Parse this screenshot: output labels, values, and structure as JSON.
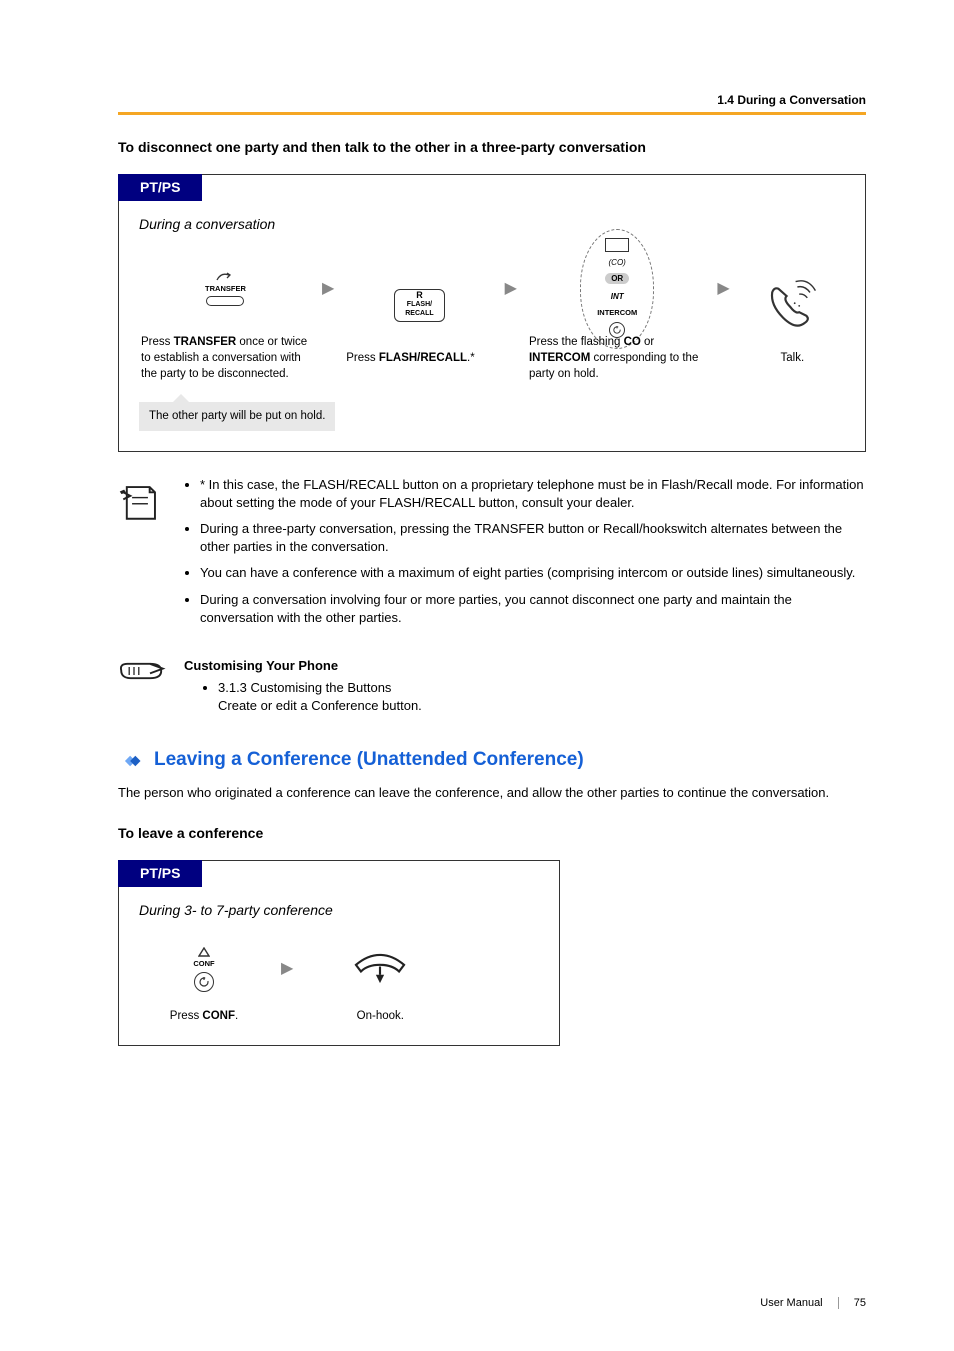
{
  "header": {
    "breadcrumb": "1.4 During a Conversation"
  },
  "subhead1": "To disconnect one party and then talk to the other in a three-party conversation",
  "flow1": {
    "title": "PT/PS",
    "context": "During a conversation",
    "steps": {
      "s1": {
        "iconLabel1": "TRANSFER",
        "caption_pre": "Press ",
        "caption_b1": "TRANSFER",
        "caption_post": " once or twice to establish a conversation with the party to be disconnected."
      },
      "s2": {
        "iconLabel1": "R",
        "iconLabel2": "FLASH/\nRECALL",
        "caption_pre": "Press ",
        "caption_b1": "FLASH/RECALL",
        "caption_post": ".*"
      },
      "s3": {
        "coLabel": "(CO)",
        "orLabel": "OR",
        "intLabel1": "INT",
        "intLabel2": "INTERCOM",
        "caption_pre": "Press the flashing ",
        "caption_b1": "CO",
        "caption_mid": " or ",
        "caption_b2": "INTERCOM",
        "caption_post": " corresponding to the party on hold."
      },
      "s4": {
        "caption": "Talk."
      }
    },
    "holdNote": "The other party will be put on hold."
  },
  "notes": {
    "n1": "* In this case, the FLASH/RECALL button on a proprietary telephone must be in Flash/Recall mode. For information about setting the mode of your FLASH/RECALL button, consult your dealer.",
    "n2": "During a three-party conversation, pressing the TRANSFER button or Recall/hookswitch alternates between the other parties in the conversation.",
    "n3": "You can have a conference with a maximum of eight parties (comprising intercom or outside lines) simultaneously.",
    "n4": "During a conversation involving four or more parties, you cannot disconnect one party and maintain the conversation with the other parties."
  },
  "custom": {
    "title": "Customising Your Phone",
    "item1": "3.1.3 Customising the Buttons",
    "item1_sub": "Create or edit a Conference button."
  },
  "section2": {
    "title": "Leaving a Conference (Unattended Conference)",
    "intro": "The person who originated a conference can leave the conference, and allow the other parties to continue the conversation.",
    "subhead": "To leave a conference"
  },
  "flow2": {
    "title": "PT/PS",
    "context": "During 3- to 7-party conference",
    "s1": {
      "iconTop": "CONF",
      "caption_pre": "Press ",
      "caption_b": "CONF",
      "caption_post": "."
    },
    "s2": {
      "caption": "On-hook."
    }
  },
  "footer": {
    "label": "User Manual",
    "page": "75"
  }
}
